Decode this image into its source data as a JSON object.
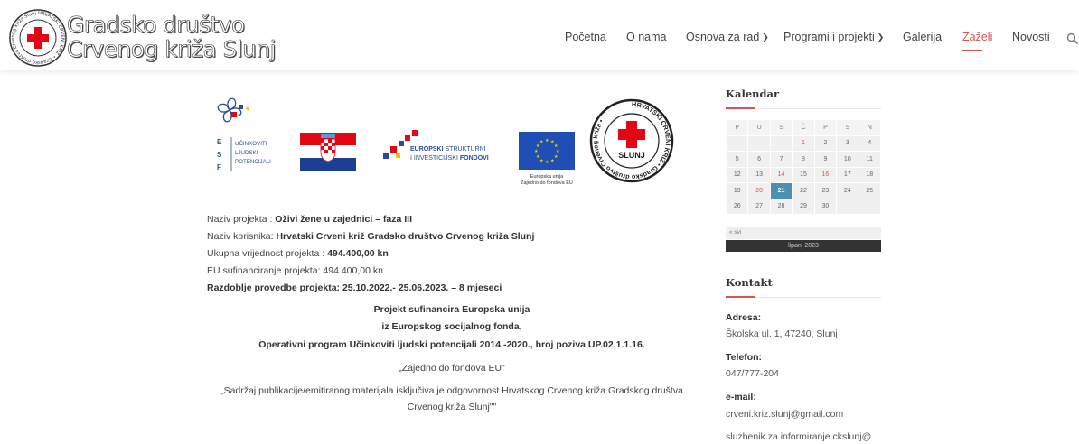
{
  "header": {
    "logo_line1": "Gradsko društvo",
    "logo_line2": "Crvenog križa Slunj",
    "badge_ring_text": "HRVATSKI CRVENI KRIŽ • Gradsko društvo Crvenog križa Slunj •"
  },
  "nav": {
    "items": [
      {
        "label": "Početna",
        "has_dropdown": false,
        "active": false
      },
      {
        "label": "O nama",
        "has_dropdown": false,
        "active": false
      },
      {
        "label": "Osnova za rad",
        "has_dropdown": true,
        "active": false
      },
      {
        "label": "Programi i projekti",
        "has_dropdown": true,
        "active": false
      },
      {
        "label": "Galerija",
        "has_dropdown": false,
        "active": false
      },
      {
        "label": "Zaželi",
        "has_dropdown": false,
        "active": true
      },
      {
        "label": "Novosti",
        "has_dropdown": false,
        "active": false
      }
    ],
    "search_icon": "search-icon",
    "accent_color": "#d9534f"
  },
  "logos": {
    "esf_letters": [
      "E",
      "S",
      "F"
    ],
    "esf_lines": [
      "UČINKOVITI",
      "LJUDSKI",
      "POTENCIJALI"
    ],
    "esif_line1_a": "EUROPSKI",
    "esif_line1_b": "STRUKTURNI",
    "esif_line2_a": "I INVESTICIJSKI",
    "esif_line2_b": "FONDOVI",
    "eu_caption1": "Europska unija",
    "eu_caption2": "Zajedno do fondova EU",
    "hck_ring": "HRVATSKI CRVENI KRIŽ • Gradsko društvo Crvenog križa •",
    "hck_center": "SLUNJ"
  },
  "project": {
    "name_label": "Naziv projekta :",
    "name_value": "Oživi žene u zajednici – faza III",
    "beneficiary_label": "Naziv korisnika:",
    "beneficiary_value": "Hrvatski Crveni križ Gradsko društvo Crvenog križa Slunj",
    "total_label": "Ukupna vrijednost projekta :",
    "total_value": "494.400,00 kn",
    "eu_cofinancing": "EU sufinanciranje projekta: 494.400,00 kn",
    "period": "Razdoblje provedbe projekta: 25.10.2022.- 25.06.2023. – 8 mjeseci",
    "cofinance_line1": "Projekt sufinancira Europska unija",
    "cofinance_line2": "iz Europskog socijalnog fonda,",
    "cofinance_line3": "Operativni program Učinkoviti ljudski potencijali 2014.-2020., broj poziva UP.02.1.1.16.",
    "slogan": "„Zajedno do fondova EU\"",
    "disclaimer_line1": "„Sadržaj publikacije/emitiranog materijala isključiva je odgovornost Hrvatskog Crvenog križa Gradskog društva",
    "disclaimer_line2": "Crvenog križa Slunj\"\""
  },
  "calendar": {
    "title": "Kalendar",
    "weekdays": [
      "P",
      "U",
      "S",
      "Č",
      "P",
      "S",
      "N"
    ],
    "weeks": [
      [
        "",
        "",
        "",
        "1",
        "2",
        "3",
        "4"
      ],
      [
        "5",
        "6",
        "7",
        "8",
        "9",
        "10",
        "11"
      ],
      [
        "12",
        "13",
        "14",
        "15",
        "16",
        "17",
        "18"
      ],
      [
        "19",
        "20",
        "21",
        "22",
        "23",
        "24",
        "25"
      ],
      [
        "26",
        "27",
        "28",
        "29",
        "30",
        "",
        ""
      ]
    ],
    "red_days": [
      "1",
      "14",
      "16",
      "20"
    ],
    "today": "21",
    "prev_link": "« svi",
    "month_label": "lipanj 2023"
  },
  "contact": {
    "title": "Kontakt",
    "address_label": "Adresa:",
    "address_value": "Školska ul. 1, 47240, Slunj",
    "phone_label": "Telefon:",
    "phone_value": "047/777-204",
    "email_label": "e-mail:",
    "email_value": "crveni.kriz.slunj@gmail.com",
    "email2_value": "sluzbenik.za.informiranje.ckslunj@"
  }
}
